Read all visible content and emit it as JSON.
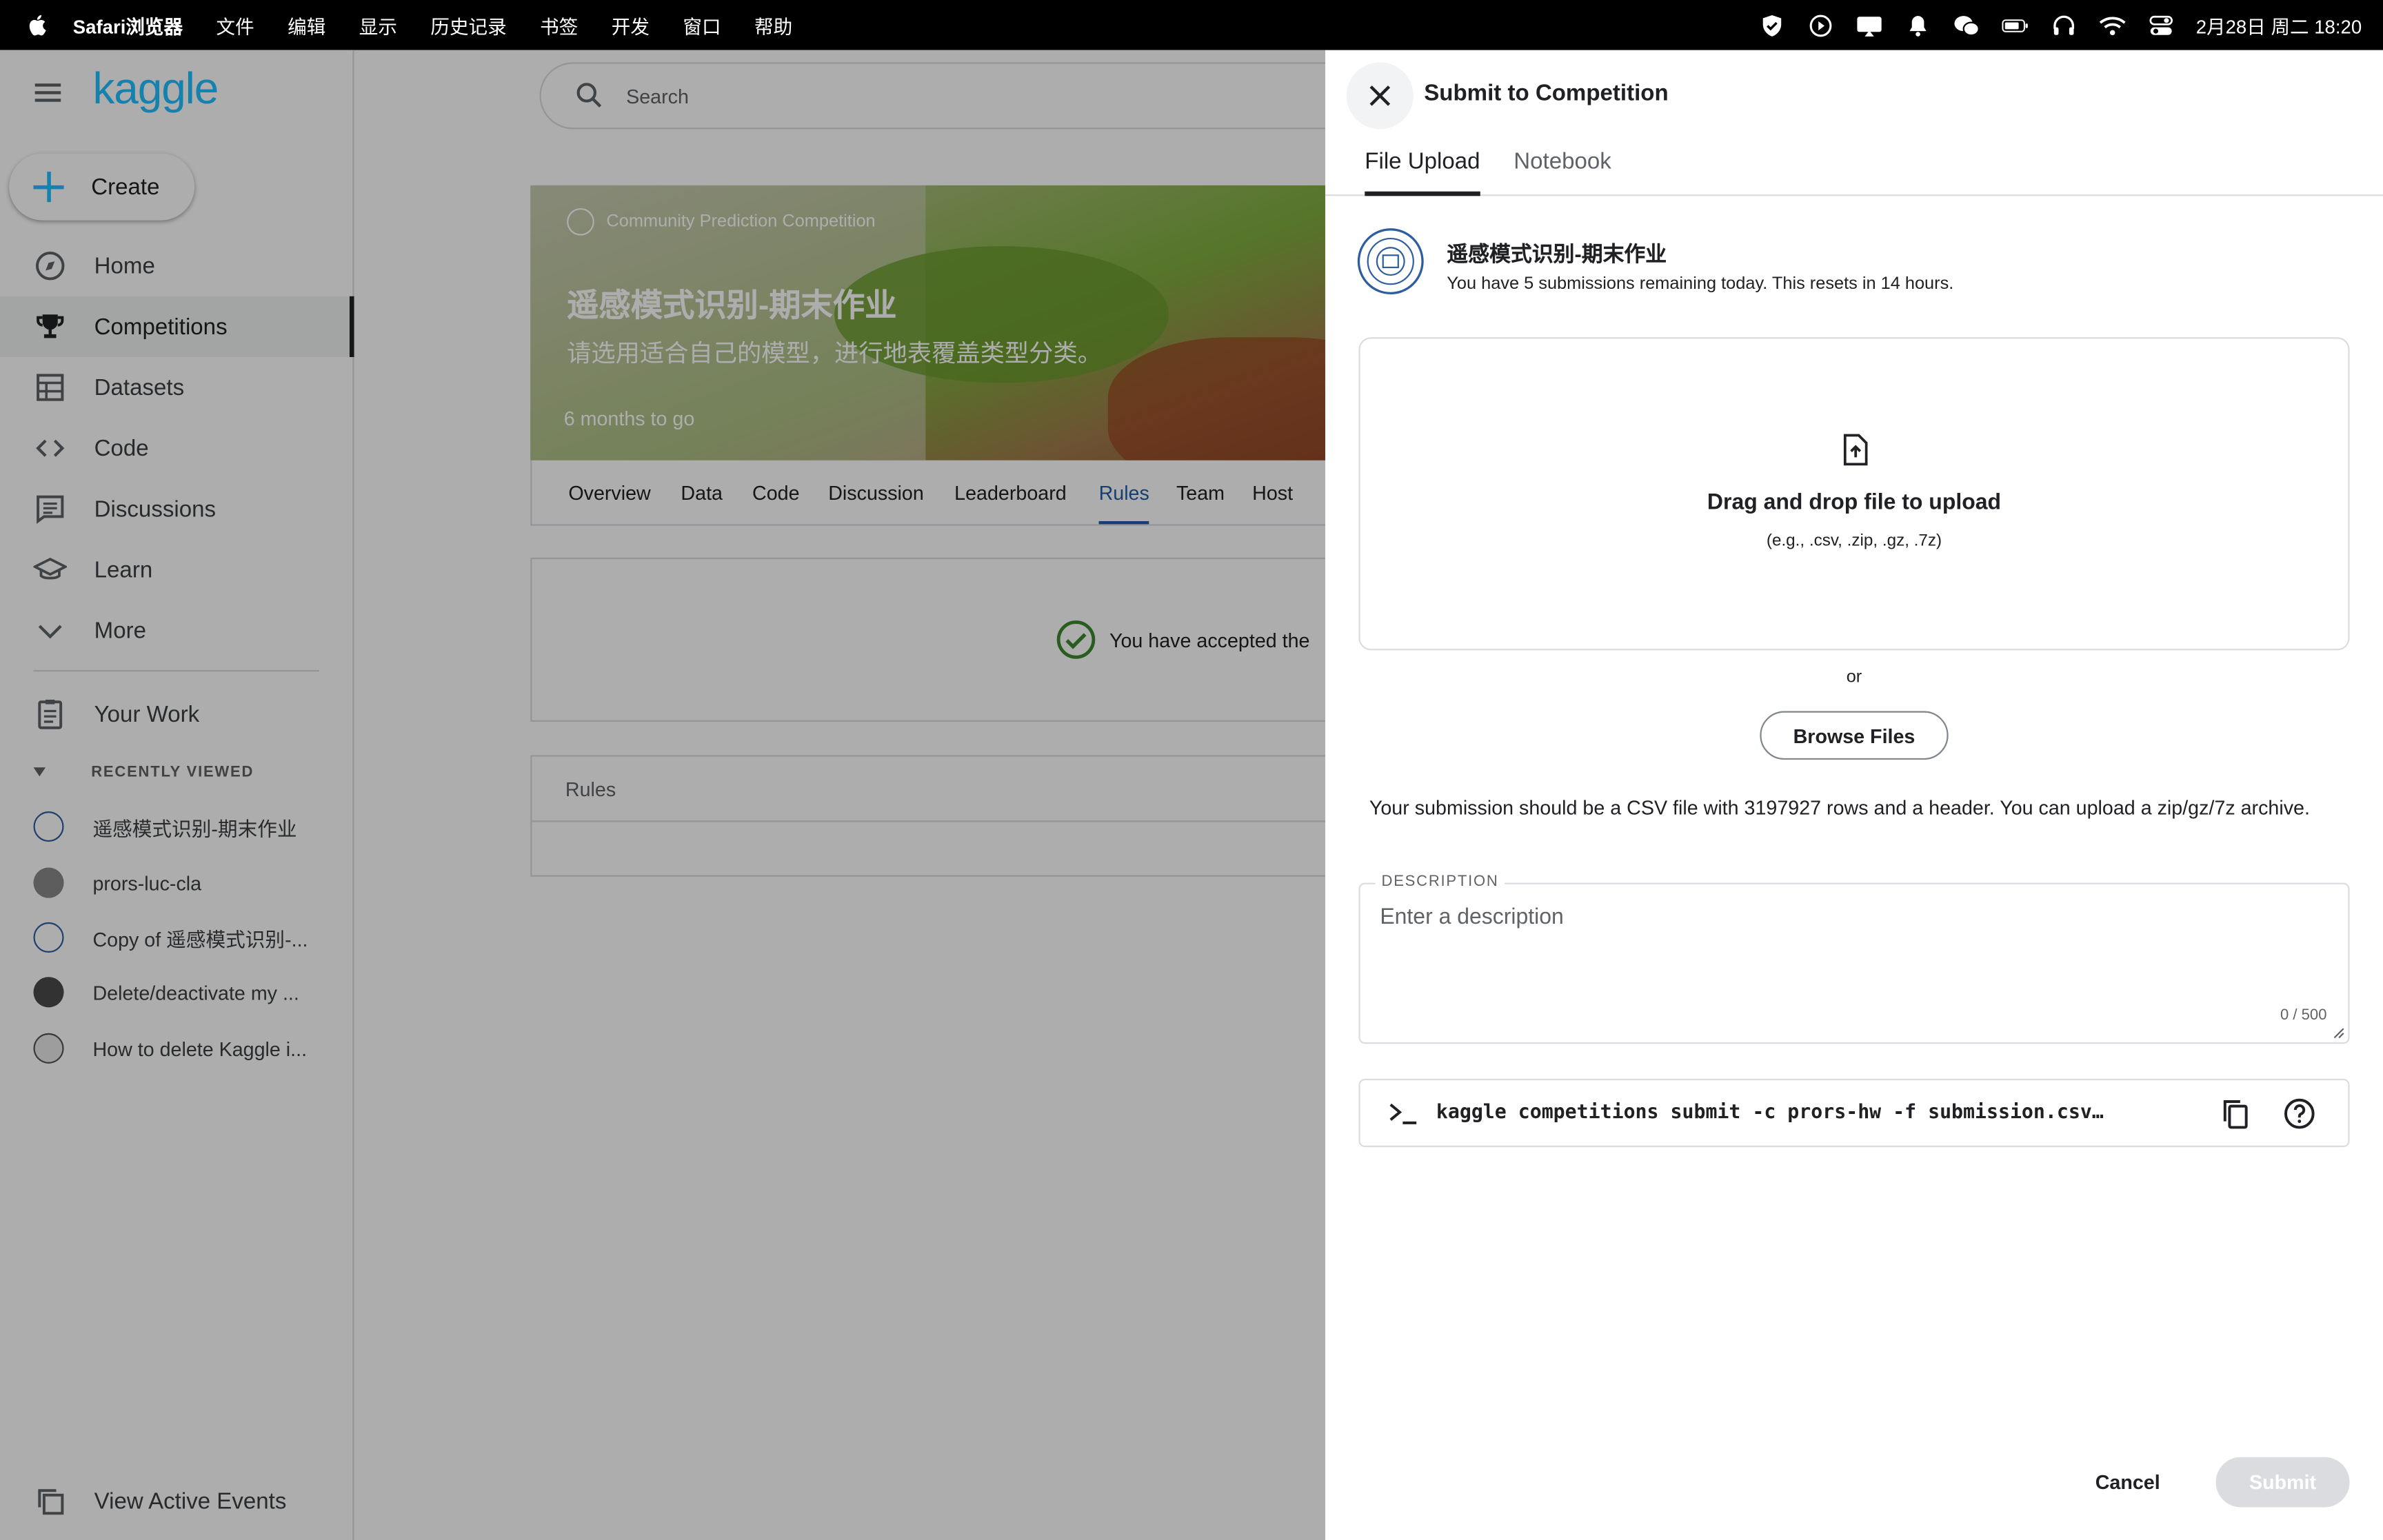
{
  "menubar": {
    "app": "Safari浏览器",
    "items": [
      "文件",
      "编辑",
      "显示",
      "历史记录",
      "书签",
      "开发",
      "窗口",
      "帮助"
    ],
    "clock": "2月28日 周二  18:20",
    "status_icons": [
      "shield-icon",
      "play-icon",
      "cast-icon",
      "bell-icon",
      "wechat-icon",
      "battery-icon",
      "headphones-icon",
      "wifi-icon",
      "control-center-icon"
    ]
  },
  "kaggle": {
    "logo": "kaggle",
    "create_label": "Create",
    "nav": [
      "Home",
      "Competitions",
      "Datasets",
      "Code",
      "Discussions",
      "Learn",
      "More"
    ],
    "your_work": "Your Work",
    "recently_viewed_heading": "RECENTLY VIEWED",
    "recent": [
      "遥感模式识别-期末作业",
      "prors-luc-cla",
      "Copy of 遥感模式识别-...",
      "Delete/deactivate my ...",
      "How to delete Kaggle i..."
    ],
    "view_active_events": "View Active Events",
    "search_placeholder": "Search",
    "competition": {
      "type": "Community Prediction Competition",
      "title": "遥感模式识别-期末作业",
      "subtitle": "请选用适合自己的模型，进行地表覆盖类型分类。",
      "deadline": "6 months to go",
      "tabs": [
        "Overview",
        "Data",
        "Code",
        "Discussion",
        "Leaderboard",
        "Rules",
        "Team",
        "Host"
      ],
      "active_tab": "Rules",
      "accepted_text": "You have accepted the",
      "rules_heading": "Rules"
    }
  },
  "dialog": {
    "title": "Submit to Competition",
    "tabs": [
      "File Upload",
      "Notebook"
    ],
    "active_tab": "File Upload",
    "competition_name": "遥感模式识别-期末作业",
    "submissions_info": "You have 5 submissions remaining today. This resets in 14 hours.",
    "drop_title": "Drag and drop file to upload",
    "drop_formats": "(e.g., .csv, .zip, .gz, .7z)",
    "or": "or",
    "browse_label": "Browse Files",
    "requirement": "Your submission should be a CSV file with 3197927 rows and a header. You can upload a zip/gz/7z archive.",
    "description_label": "DESCRIPTION",
    "description_placeholder": "Enter a description",
    "description_value": "",
    "char_count": "0 / 500",
    "cli_command": "kaggle competitions submit -c prors-hw -f submission.csv…",
    "cancel_label": "Cancel",
    "submit_label": "Submit"
  },
  "colors": {
    "kaggle_blue": "#20beff",
    "active_tab_blue": "#1f5ea8",
    "check_green": "#3c8a2e",
    "submit_disabled": "#dadce0"
  }
}
